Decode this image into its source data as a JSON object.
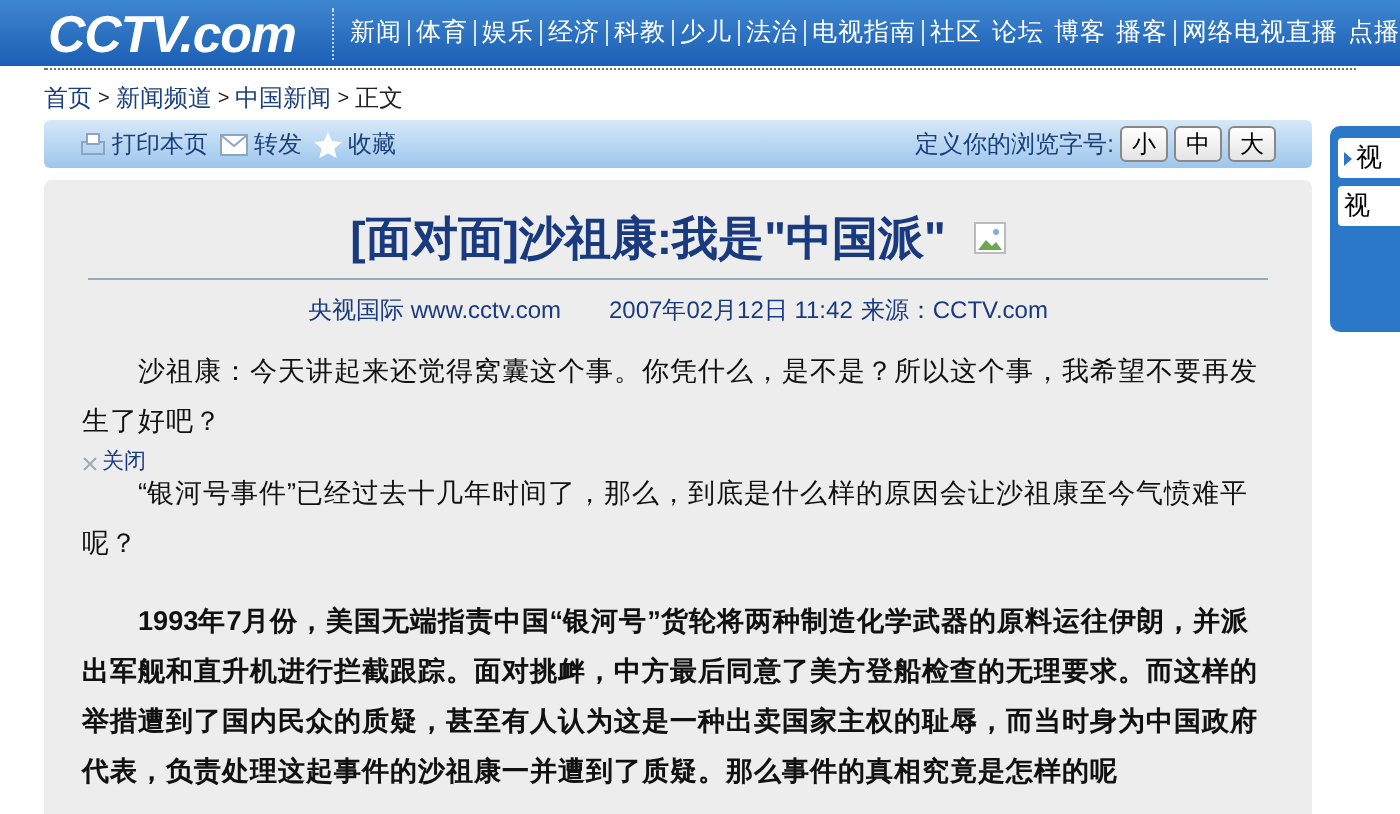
{
  "header": {
    "logo": "CCTV.com",
    "nav": [
      [
        "新闻"
      ],
      [
        "体育"
      ],
      [
        "娱乐"
      ],
      [
        "经济"
      ],
      [
        "科教"
      ],
      [
        "少儿"
      ],
      [
        "法治"
      ],
      [
        "电视指南"
      ],
      [
        "社区",
        "论坛",
        "博客",
        "播客"
      ],
      [
        "网络电视直播",
        "点播"
      ]
    ]
  },
  "breadcrumb": {
    "separator": ">",
    "items": [
      "首页",
      "新闻频道",
      "中国新闻",
      "正文"
    ]
  },
  "toolbar": {
    "actions": [
      {
        "label": "打印本页",
        "kind": "print"
      },
      {
        "label": "转发",
        "kind": "mail"
      },
      {
        "label": "收藏",
        "kind": "star"
      }
    ],
    "font_size_label": "定义你的浏览字号:",
    "font_sizes": [
      "小",
      "中",
      "大"
    ]
  },
  "article": {
    "title": "[面对面]沙祖康:我是\"中国派\"",
    "meta": {
      "publisher": "央视国际 www.cctv.com",
      "date": "2007年02月12日 11:42",
      "source_label": "来源：",
      "source": "CCTV.com"
    },
    "paragraphs": [
      {
        "text": "沙祖康：今天讲起来还觉得窝囊这个事。你凭什么，是不是？所以这个事，我希望不要再发生了好吧？",
        "bold": false
      },
      {
        "text": "“银河号事件”已经过去十几年时间了，那么，到底是什么样的原因会让沙祖康至今气愤难平呢？",
        "bold": false,
        "close_label": "关闭"
      },
      {
        "text": "1993年7月份，美国无端指责中国“银河号”货轮将两种制造化学武器的原料运往伊朗，并派出军舰和直升机进行拦截跟踪。面对挑衅，中方最后同意了美方登船检查的无理要求。而这样的举措遭到了国内民众的质疑，甚至有人认为这是一种出卖国家主权的耻辱，而当时身为中国政府代表，负责处理这起事件的沙祖康一并遭到了质疑。那么事件的真相究竟是怎样的呢",
        "bold": true
      }
    ]
  },
  "side_panel": {
    "items": [
      "视",
      "视"
    ]
  }
}
